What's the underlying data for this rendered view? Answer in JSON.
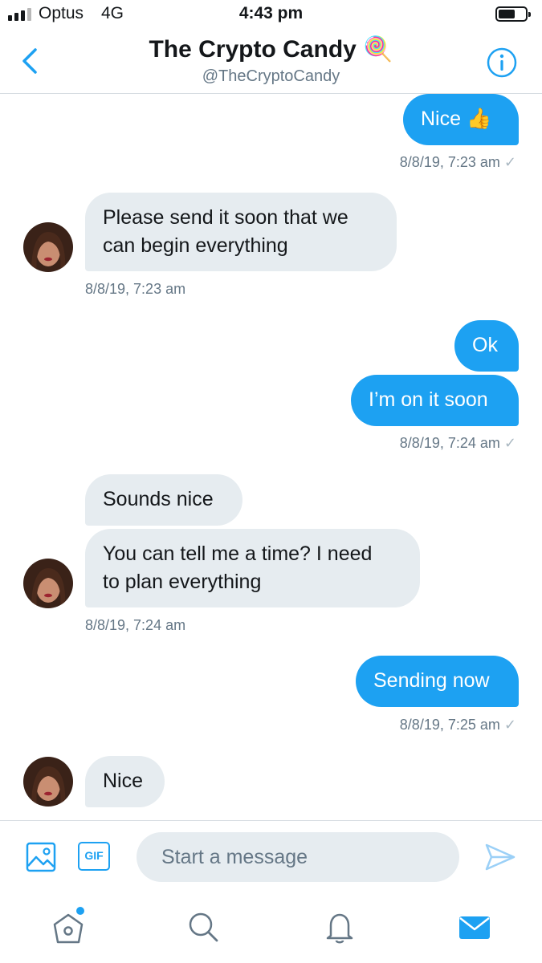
{
  "status_bar": {
    "carrier": "Optus",
    "network": "4G",
    "time": "4:43 pm"
  },
  "header": {
    "title": "The Crypto Candy 🍭",
    "handle": "@TheCryptoCandy"
  },
  "messages": [
    {
      "text": "Nice 👍"
    },
    {
      "text": "8/8/19, 7:23 am"
    },
    {
      "line1": "Please send it soon that we",
      "line2": "can begin everything"
    },
    {
      "text": "8/8/19, 7:23 am"
    },
    {
      "text": "Ok"
    },
    {
      "text": "I’m on it soon"
    },
    {
      "text": "8/8/19, 7:24 am"
    },
    {
      "text": "Sounds nice"
    },
    {
      "line1": "You can tell me a time? I need",
      "line2": "to plan everything"
    },
    {
      "text": "8/8/19, 7:24 am"
    },
    {
      "text": "Sending now"
    },
    {
      "text": "8/8/19, 7:25 am"
    },
    {
      "text": "Nice"
    }
  ],
  "composer": {
    "placeholder": "Start a message",
    "gif_label": "GIF"
  },
  "colors": {
    "accent": "#1da1f2",
    "incoming_bubble": "#e6ecf0",
    "muted_text": "#657786"
  }
}
